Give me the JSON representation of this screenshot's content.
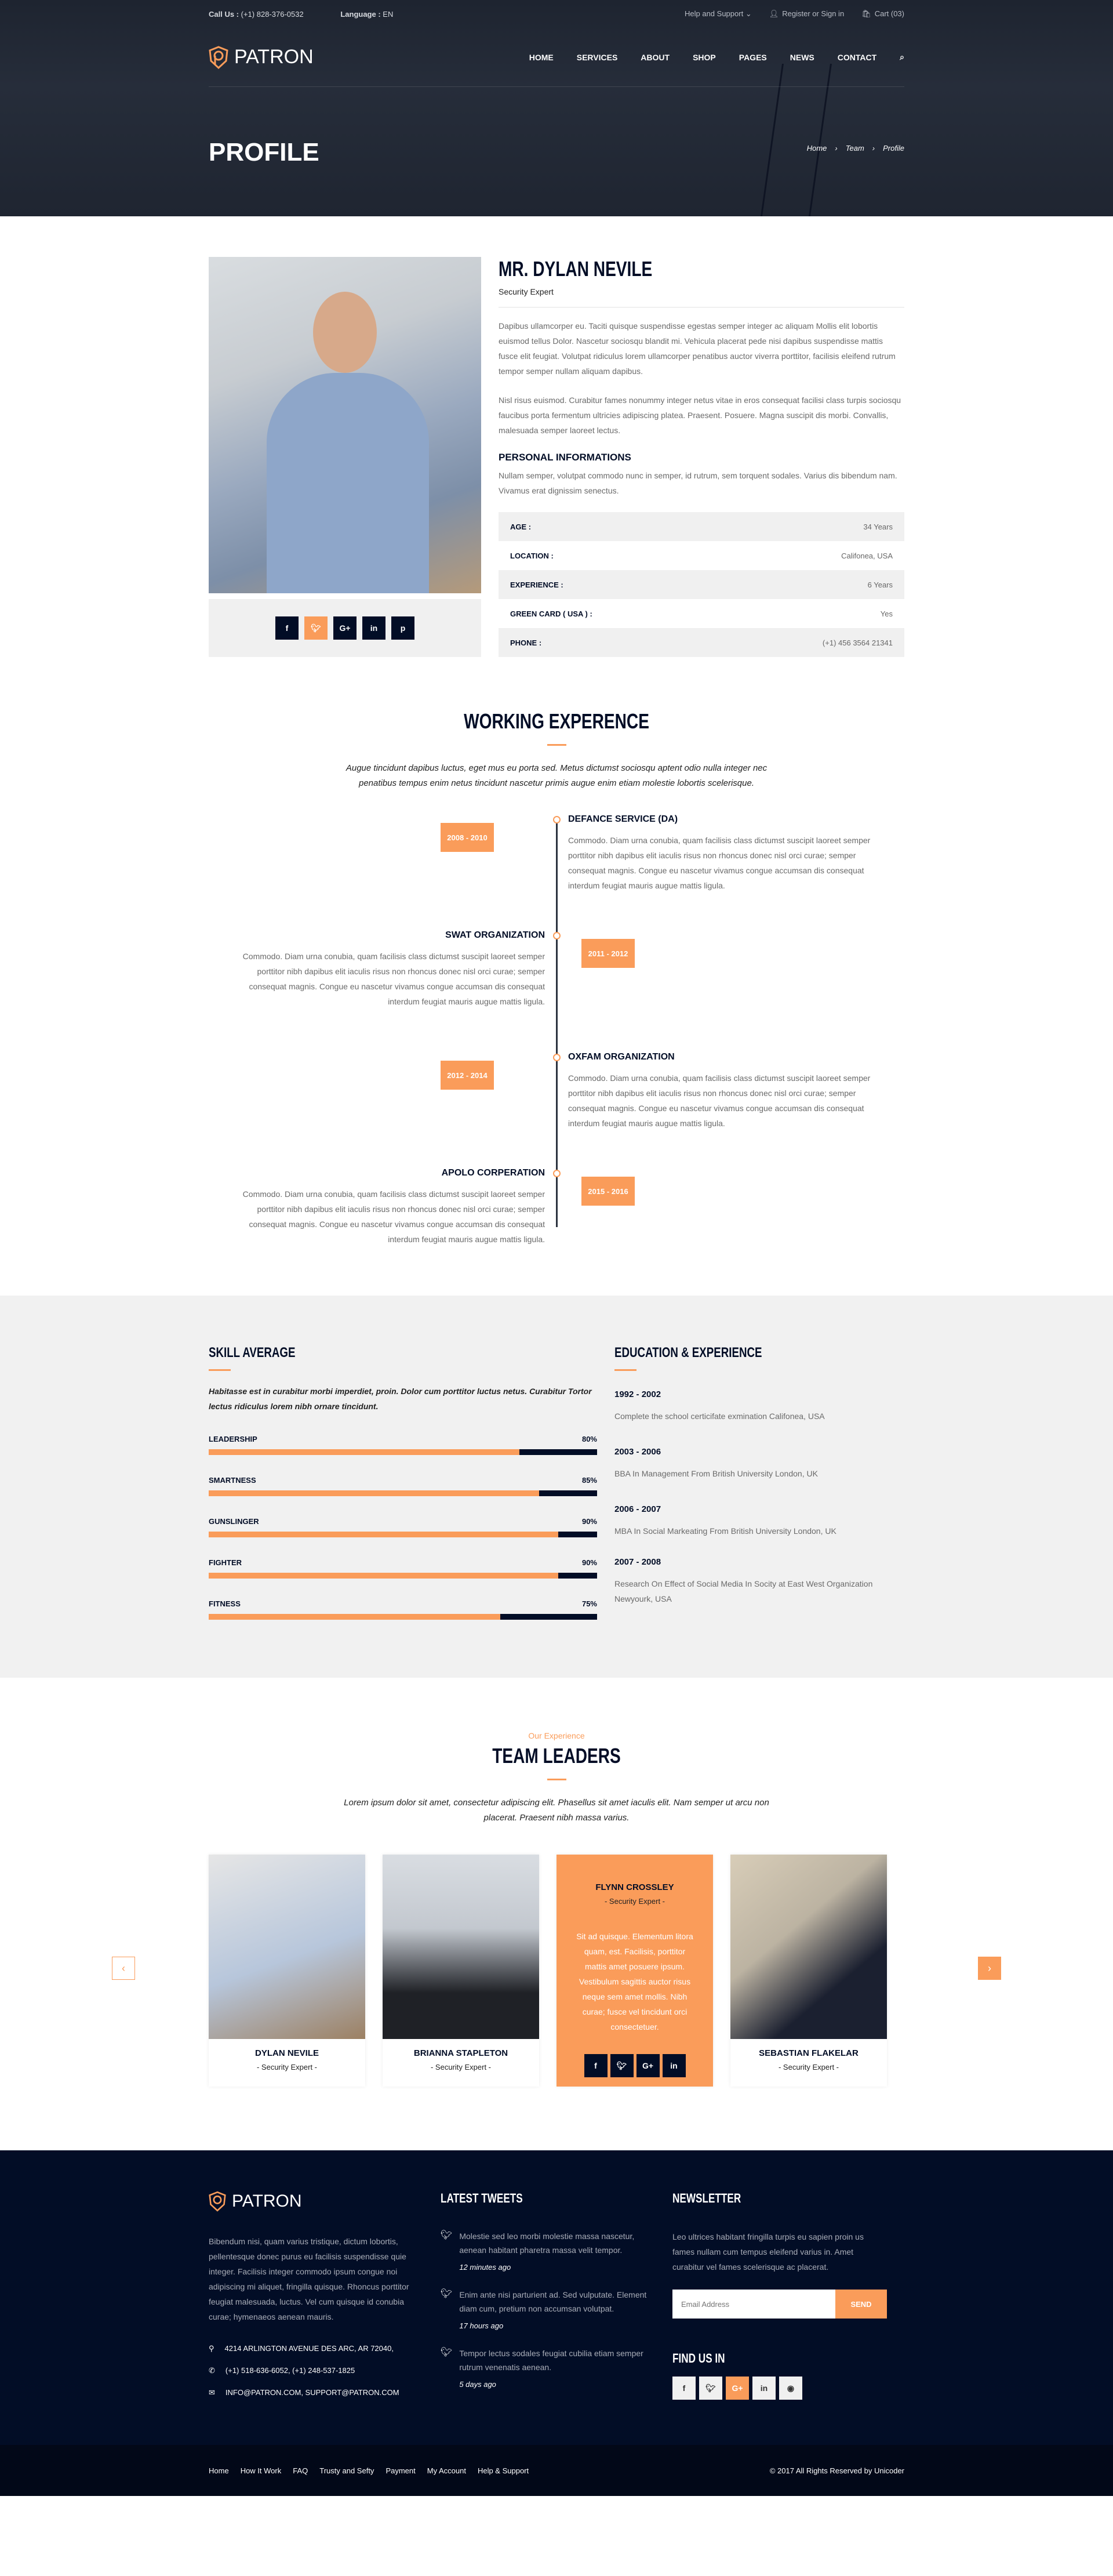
{
  "colors": {
    "accent": "#fa9c5a",
    "navy": "#020d26"
  },
  "topbar": {
    "call_label": "Call Us :",
    "call_value": "(+1) 828-376-0532",
    "lang_label": "Language :",
    "lang_value": "EN",
    "help": "Help and Support",
    "register": "Register or Sign in",
    "cart": "Cart (03)"
  },
  "brand": "PATRON",
  "nav": [
    "HOME",
    "SERVICES",
    "ABOUT",
    "SHOP",
    "PAGES",
    "NEWS",
    "CONTACT"
  ],
  "page_title": "PROFILE",
  "breadcrumb": [
    "Home",
    "Team",
    "Profile"
  ],
  "profile": {
    "name": "MR. DYLAN NEVILE",
    "role": "Security Expert",
    "bio1": "Dapibus ullamcorper eu. Taciti quisque suspendisse egestas semper integer ac aliquam Mollis elit lobortis euismod tellus Dolor. Nascetur sociosqu blandit mi. Vehicula placerat pede nisi dapibus suspendisse mattis fusce elit feugiat. Volutpat ridiculus lorem ullamcorper penatibus auctor viverra porttitor, facilisis eleifend rutrum tempor semper nullam aliquam dapibus.",
    "bio2": "Nisl risus euismod. Curabitur fames nonummy integer netus vitae in eros consequat facilisi class turpis sociosqu faucibus porta fermentum ultricies adipiscing platea. Praesent. Posuere. Magna suscipit dis morbi. Convallis, malesuada semper laoreet lectus.",
    "personal_title": "PERSONAL INFORMATIONS",
    "personal_text": "Nullam semper, volutpat commodo nunc in semper, id rutrum, sem torquent sodales. Varius dis bibendum nam. Vivamus erat dignissim senectus.",
    "rows": [
      {
        "k": "AGE :",
        "v": "34 Years"
      },
      {
        "k": "LOCATION :",
        "v": "Califonea, USA"
      },
      {
        "k": "EXPERIENCE :",
        "v": "6 Years"
      },
      {
        "k": "GREEN CARD ( USA ) :",
        "v": "Yes"
      },
      {
        "k": "PHONE :",
        "v": "(+1) 456 3564 21341"
      }
    ],
    "social": [
      "f",
      "t",
      "G+",
      "in",
      "p"
    ]
  },
  "working": {
    "title": "WORKING EXPERENCE",
    "lead": "Augue tincidunt dapibus luctus, eget mus eu porta sed. Metus dictumst sociosqu aptent odio nulla integer nec penatibus tempus enim netus tincidunt nascetur primis augue enim etiam molestie lobortis scelerisque.",
    "items": [
      {
        "years": "2008 - 2010",
        "title": "DEFANCE SERVICE (DA)",
        "text": "Commodo. Diam urna conubia, quam facilisis class dictumst suscipit laoreet semper porttitor nibh dapibus elit iaculis risus non rhoncus donec nisl orci curae; semper consequat magnis. Congue eu nascetur vivamus congue accumsan dis consequat interdum feugiat mauris augue mattis ligula."
      },
      {
        "years": "2011 - 2012",
        "title": "SWAT ORGANIZATION",
        "text": "Commodo. Diam urna conubia, quam facilisis class dictumst suscipit laoreet semper porttitor nibh dapibus elit iaculis risus non rhoncus donec nisl orci curae; semper consequat magnis. Congue eu nascetur vivamus congue accumsan dis consequat interdum feugiat mauris augue mattis ligula."
      },
      {
        "years": "2012 - 2014",
        "title": "OXFAM ORGANIZATION",
        "text": "Commodo. Diam urna conubia, quam facilisis class dictumst suscipit laoreet semper porttitor nibh dapibus elit iaculis risus non rhoncus donec nisl orci curae; semper consequat magnis. Congue eu nascetur vivamus congue accumsan dis consequat interdum feugiat mauris augue mattis ligula."
      },
      {
        "years": "2015 - 2016",
        "title": "APOLO CORPERATION",
        "text": "Commodo. Diam urna conubia, quam facilisis class dictumst suscipit laoreet semper porttitor nibh dapibus elit iaculis risus non rhoncus donec nisl orci curae; semper consequat magnis. Congue eu nascetur vivamus congue accumsan dis consequat interdum feugiat mauris augue mattis ligula."
      }
    ]
  },
  "skills": {
    "title": "SKILL AVERAGE",
    "text": "Habitasse est in curabitur morbi imperdiet, proin. Dolor cum porttitor luctus netus. Curabitur Tortor lectus ridiculus lorem nibh ornare tincidunt.",
    "items": [
      {
        "name": "LEADERSHIP",
        "value": 80,
        "label": "80%"
      },
      {
        "name": "SMARTNESS",
        "value": 85,
        "label": "85%"
      },
      {
        "name": "GUNSLINGER",
        "value": 90,
        "label": "90%"
      },
      {
        "name": "FIGHTER",
        "value": 90,
        "label": "90%"
      },
      {
        "name": "FITNESS",
        "value": 75,
        "label": "75%"
      }
    ]
  },
  "education": {
    "title": "EDUCATION & EXPERIENCE",
    "items": [
      {
        "years": "1992 - 2002",
        "text": "Complete the school certicifate exmination Califonea, USA"
      },
      {
        "years": "2003 - 2006",
        "text": "BBA In Management From British University London, UK"
      },
      {
        "years": "2006 - 2007",
        "text": "MBA In Social Markeating From British University London, UK"
      },
      {
        "years": "2007 - 2008",
        "text": "Research On Effect of Social Media In Socity at East West Organization Newyourk, USA"
      }
    ]
  },
  "team": {
    "kicker": "Our Experience",
    "title": "TEAM LEADERS",
    "lead": "Lorem ipsum dolor sit amet, consectetur adipiscing elit. Phasellus sit amet iaculis elit. Nam semper ut arcu non placerat. Praesent nibh massa varius.",
    "members": [
      {
        "name": "DYLAN NEVILE",
        "role": "- Security Expert -"
      },
      {
        "name": "BRIANNA STAPLETON",
        "role": "- Security Expert -"
      },
      {
        "name": "FLYNN CROSSLEY",
        "role": "- Security Expert -",
        "text": "Sit ad quisque. Elementum litora quam, est. Facilisis, porttitor mattis amet posuere ipsum. Vestibulum sagittis auctor risus neque sem amet mollis. Nibh curae; fusce vel tincidunt orci consectetuer."
      },
      {
        "name": "SEBASTIAN FLAKELAR",
        "role": "- Security Expert -"
      }
    ],
    "prev": "‹",
    "next": "›"
  },
  "footer": {
    "about": "Bibendum nisi, quam varius tristique, dictum lobortis, pellentesque donec purus eu facilisis suspendisse quie integer. Facilisis integer commodo ipsum congue noi adipiscing mi aliquet, fringilla quisque. Rhoncus porttitor feugiat malesuada, luctus. Vel cum quisque id conubia curae; hymenaeos aenean mauris.",
    "address": "4214 ARLINGTON AVENUE DES ARC, AR 72040,",
    "phones": "(+1) 518-636-6052, (+1) 248-537-1825",
    "emails": "INFO@PATRON.COM, SUPPORT@PATRON.COM",
    "tweets_title": "LATEST TWEETS",
    "tweets": [
      {
        "text": "Molestie sed leo morbi molestie massa nascetur, aenean habitant pharetra massa velit tempor.",
        "ago": "12 minutes ago"
      },
      {
        "text": "Enim ante nisi parturient ad. Sed vulputate. Element diam cum, pretium non accumsan volutpat.",
        "ago": "17 hours ago"
      },
      {
        "text": "Tempor lectus sodales feugiat cubilia etiam semper rutrum venenatis aenean.",
        "ago": "5 days ago"
      }
    ],
    "newsletter_title": "NEWSLETTER",
    "newsletter_text": "Leo ultrices habitant fringilla turpis eu sapien proin us fames nullam cum tempus eleifend varius in. Amet curabitur vel fames scelerisque ac placerat.",
    "email_placeholder": "Email Address",
    "send": "SEND",
    "find_title": "FIND US IN",
    "social": [
      "f",
      "t",
      "G+",
      "in",
      "rss"
    ],
    "links": [
      "Home",
      "How It Work",
      "FAQ",
      "Trusty and Sefty",
      "Payment",
      "My Account",
      "Help & Support"
    ],
    "copyright": "© 2017 All Rights Reserved by Unicoder"
  }
}
